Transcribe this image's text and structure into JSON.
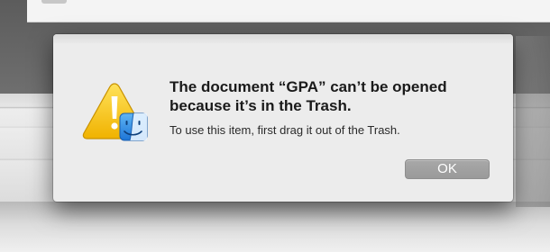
{
  "dialog": {
    "title": "The document “GPA” can’t be opened because it’s in the Trash.",
    "message": "To use this item, first drag it out of the Trash.",
    "ok_label": "OK",
    "icon": "caution-finder-icon"
  },
  "colors": {
    "dialog_background": "#ececec",
    "button_background": "#9e9e9e",
    "button_text": "#ffffff",
    "warning_yellow": "#f4c21e",
    "finder_blue": "#2f8fe0"
  }
}
